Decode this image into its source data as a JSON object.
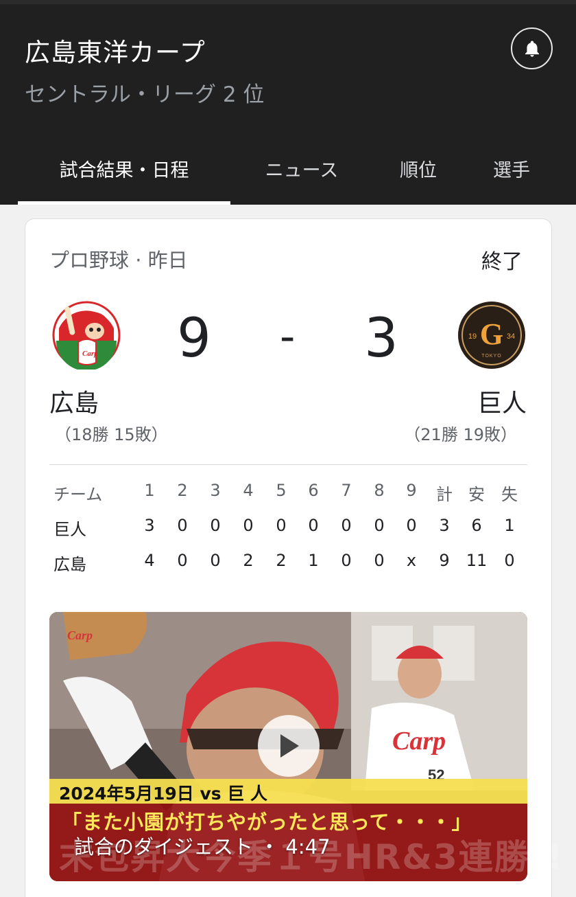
{
  "header": {
    "title": "広島東洋カープ",
    "subtitle": "セントラル・リーグ 2 位",
    "bell_icon": "bell-icon"
  },
  "tabs": [
    {
      "label": "試合結果・日程",
      "active": true
    },
    {
      "label": "ニュース",
      "active": false
    },
    {
      "label": "順位",
      "active": false
    },
    {
      "label": "選手",
      "active": false
    }
  ],
  "game": {
    "meta": "プロ野球 · 昨日",
    "status": "終了",
    "home": {
      "name": "広島",
      "record": "（18勝 15敗）",
      "score": "9",
      "logo": "carp-logo"
    },
    "separator": "-",
    "away": {
      "name": "巨人",
      "record": "（21勝 19敗）",
      "score": "3",
      "logo": "giants-logo",
      "logo_text_left": "19",
      "logo_text_right": "34",
      "logo_text_bottom": "TOKYO"
    },
    "colors": {
      "carp_red": "#d8262b",
      "giants_orange": "#f0a23a"
    }
  },
  "linescore": {
    "headers": [
      "チーム",
      "1",
      "2",
      "3",
      "4",
      "5",
      "6",
      "7",
      "8",
      "9",
      "計",
      "安",
      "失"
    ],
    "rows": [
      [
        "巨人",
        "3",
        "0",
        "0",
        "0",
        "0",
        "0",
        "0",
        "0",
        "0",
        "3",
        "6",
        "1"
      ],
      [
        "広島",
        "4",
        "0",
        "0",
        "2",
        "2",
        "1",
        "0",
        "0",
        "x",
        "9",
        "11",
        "0"
      ]
    ]
  },
  "video": {
    "date_line": "2024年5月19日 vs 巨 人",
    "quote": "「また小園が打ちやがったと思って・・・」",
    "headline": "末包昇大今季１号HR&3連勝!!",
    "caption": "試合のダイジェスト ・ 4:47",
    "play_icon": "play-icon"
  }
}
